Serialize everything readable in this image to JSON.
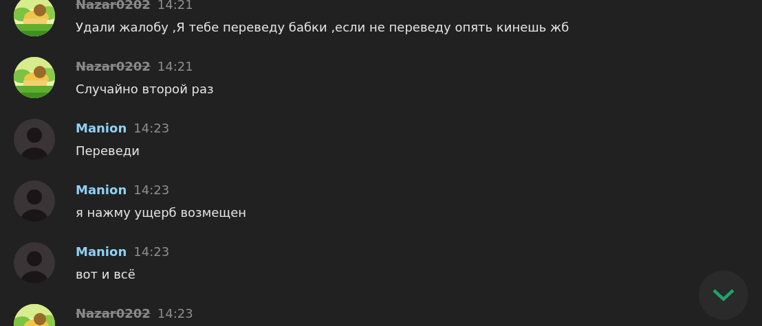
{
  "messages": [
    {
      "author": "Nazar0202",
      "struck": true,
      "color": "#8a8a8a",
      "time": "14:21",
      "text": "Удали жалобу ,Я тебе переведу бабки ,если не переведу опять кинешь жб"
    },
    {
      "author": "Nazar0202",
      "struck": true,
      "color": "#8a8a8a",
      "time": "14:21",
      "text": "Случайно второй раз"
    },
    {
      "author": "Manion",
      "struck": false,
      "color": "#8fd0f5",
      "avatar": {
        "kind": "silhouette"
      },
      "time": "14:23",
      "text": "Переведи"
    },
    {
      "author": "Manion",
      "struck": false,
      "color": "#8fd0f5",
      "avatar": {
        "kind": "silhouette"
      },
      "time": "14:23",
      "text": "я нажму ущерб возмещен"
    },
    {
      "author": "Manion",
      "struck": false,
      "color": "#8fd0f5",
      "avatar": {
        "kind": "silhouette"
      },
      "time": "14:23",
      "text": "вот и всё"
    },
    {
      "author": "Nazar0202",
      "struck": true,
      "color": "#8a8a8a",
      "time": "14:23"
    }
  ]
}
